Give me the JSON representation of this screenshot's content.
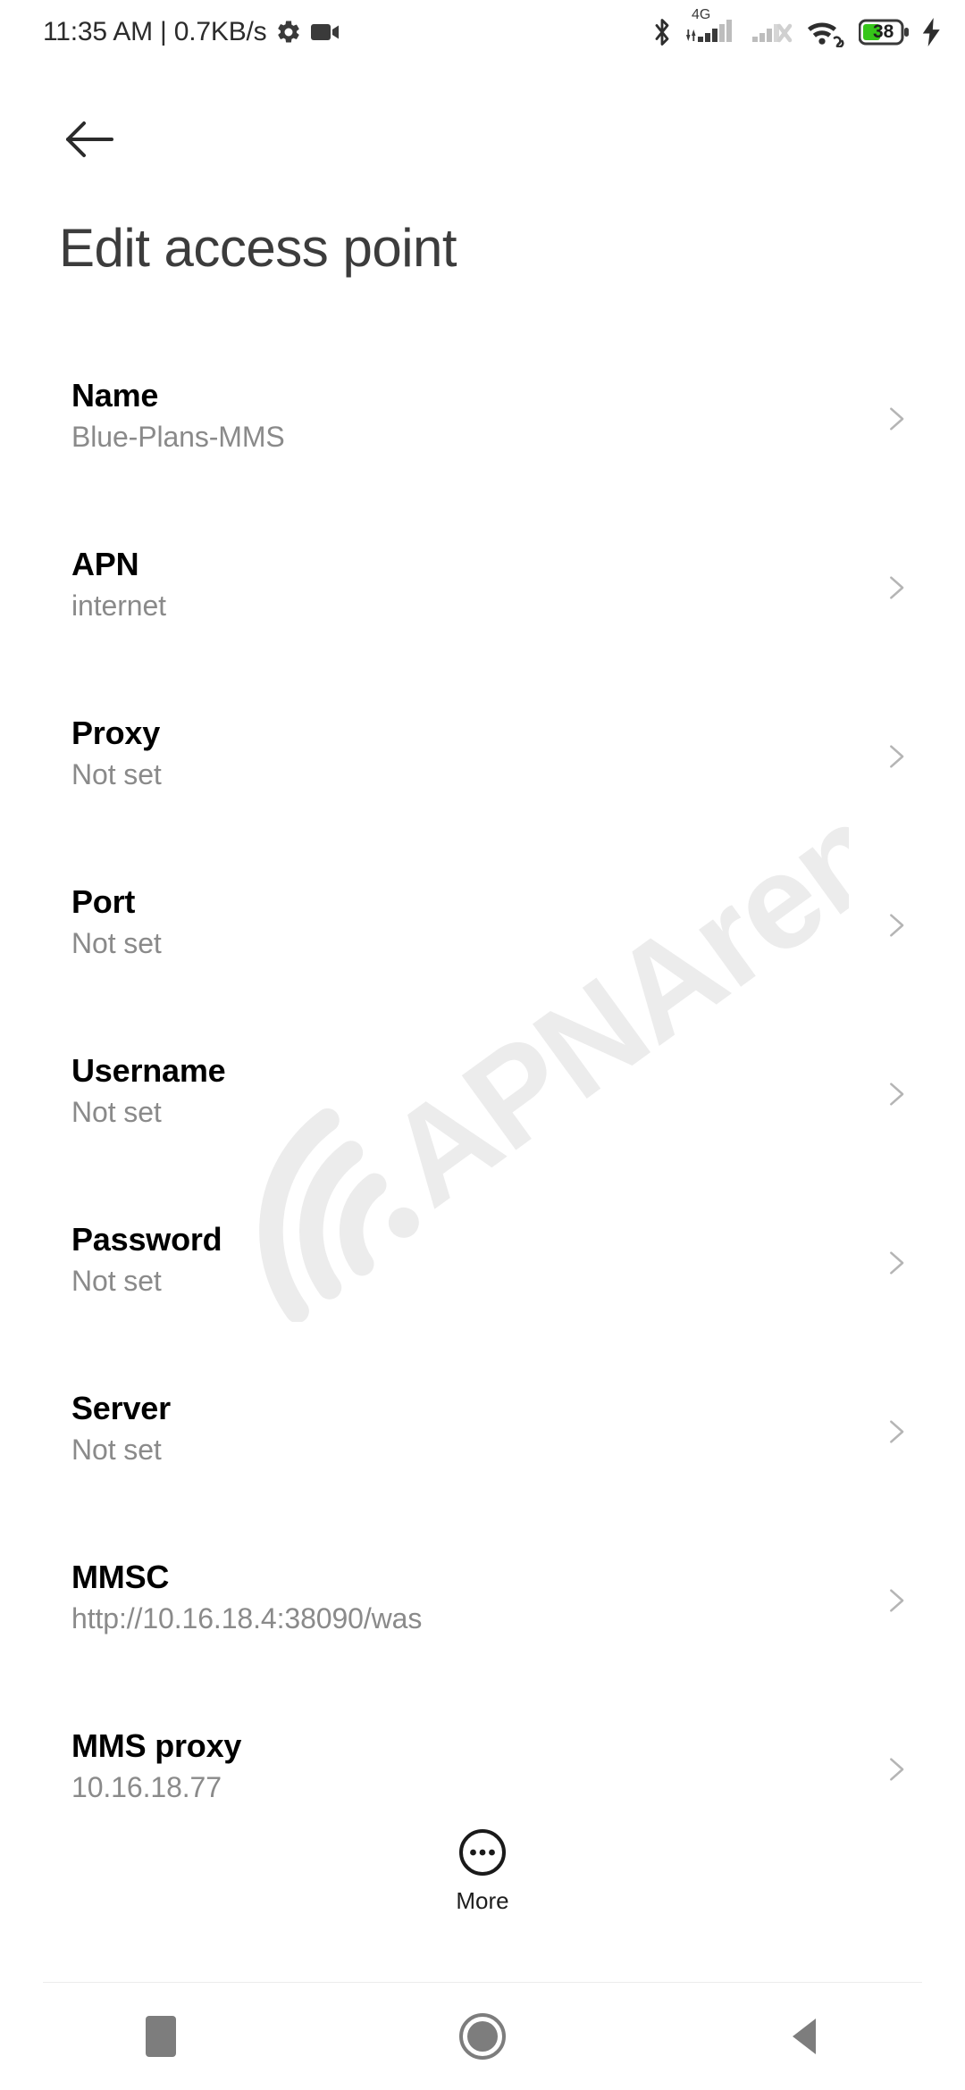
{
  "status_bar": {
    "clock": "11:35 AM | 0.7KB/s",
    "icons": {
      "settings": "gear-icon",
      "recording": "video-camera-icon",
      "bluetooth": "bluetooth-icon",
      "network_type": "4G",
      "sim1_signal": "signal-bars-icon",
      "sim2_signal": "signal-no-service-icon",
      "wifi": "wifi-link-icon",
      "battery": "battery-icon",
      "charging": "charging-bolt-icon"
    },
    "battery_level": "38"
  },
  "header": {
    "back_icon": "arrow-left-icon",
    "title": "Edit access point"
  },
  "watermark": {
    "text": "APNArena",
    "color": "#ebebeb"
  },
  "colors": {
    "title_text": "#3c3c3c",
    "row_title": "#000000",
    "row_value": "#8a8a8a",
    "chevron": "#b5b5b5",
    "battery_green": "#35c518",
    "background": "#ffffff"
  },
  "settings_list": [
    {
      "label": "Name",
      "value": "Blue-Plans-MMS"
    },
    {
      "label": "APN",
      "value": "internet"
    },
    {
      "label": "Proxy",
      "value": "Not set"
    },
    {
      "label": "Port",
      "value": "Not set"
    },
    {
      "label": "Username",
      "value": "Not set"
    },
    {
      "label": "Password",
      "value": "Not set"
    },
    {
      "label": "Server",
      "value": "Not set"
    },
    {
      "label": "MMSC",
      "value": "http://10.16.18.4:38090/was"
    },
    {
      "label": "MMS proxy",
      "value": "10.16.18.77"
    }
  ],
  "more_button": {
    "label": "More",
    "icon": "more-horizontal-circle-icon"
  },
  "nav_bar": {
    "recents": "square-icon",
    "home": "circle-icon",
    "back": "triangle-left-icon"
  }
}
